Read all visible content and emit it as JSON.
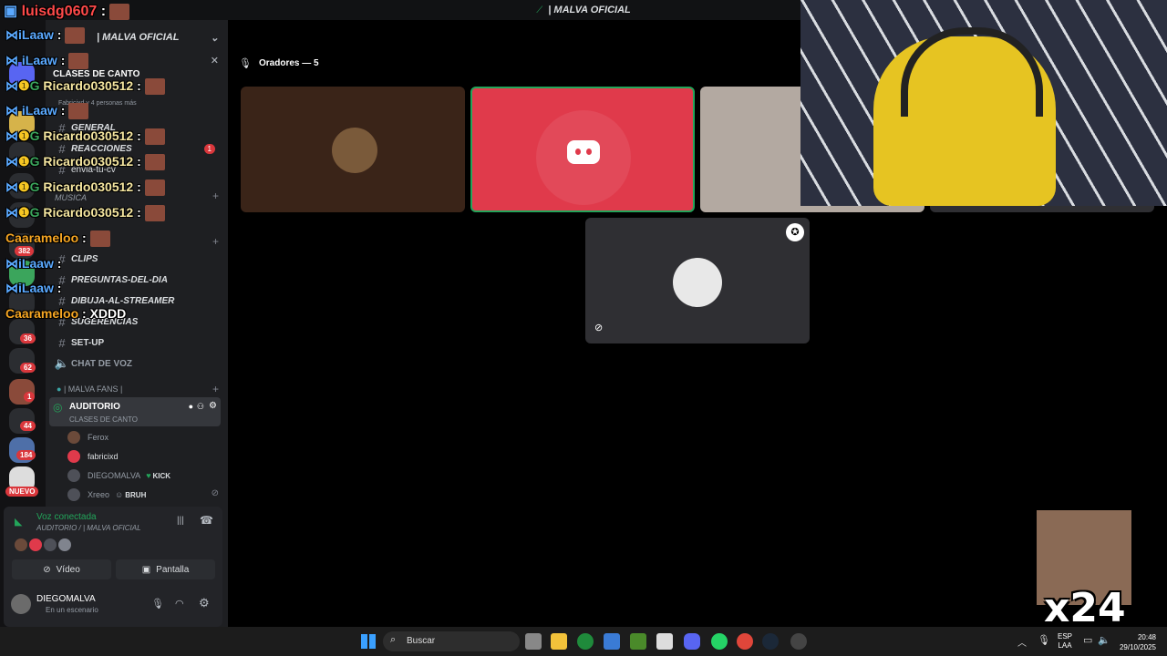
{
  "window": {
    "title": "| MALVA OFICIAL"
  },
  "rail": {
    "badges": [
      "382",
      "1",
      "36",
      "62",
      "1",
      "44",
      "184"
    ],
    "new_label": "NUEVO"
  },
  "server": {
    "name": "| MALVA OFICIAL",
    "event_title": "CLASES DE CANTO",
    "event_sub": "Fabricixd y 4 personas más"
  },
  "channels": [
    {
      "name": "GENERAL"
    },
    {
      "name": "REACCIONES",
      "badge": "1"
    },
    {
      "name": "envia-tu-cv"
    },
    {
      "name": "MUSICA"
    },
    {
      "name": "CLIPS"
    },
    {
      "name": "PREGUNTAS-DEL-DIA"
    },
    {
      "name": "DIBUJA-AL-STREAMER"
    },
    {
      "name": "SUGERENCIAS"
    },
    {
      "name": "SET-UP"
    },
    {
      "name": "CHAT DE VOZ"
    }
  ],
  "fans_category": "| MALVA FANS |",
  "auditorio": {
    "name": "AUDITORIO",
    "topic": "CLASES DE CANTO"
  },
  "stage_users": [
    {
      "name": "Ferox"
    },
    {
      "name": "fabricixd"
    },
    {
      "name": "DIEGOMALVA",
      "tag": "KICK"
    },
    {
      "name": "Xreeo",
      "tag": "BRUH"
    }
  ],
  "voice": {
    "status": "Voz conectada",
    "location": "AUDITORIO / | MALVA OFICIAL",
    "video_label": "Vídeo",
    "screen_label": "Pantalla"
  },
  "user_panel": {
    "name": "DIEGOMALVA",
    "status": "En un escenario"
  },
  "stage": {
    "speakers_label": "Oradores — 5"
  },
  "stream_chat": [
    {
      "user": "luisdg0607",
      "text": ":"
    },
    {
      "user": "iLaaw",
      "text": ":"
    },
    {
      "user": "iLaaw",
      "text": ":"
    },
    {
      "user": "Ricardo030512",
      "text": ":"
    },
    {
      "user": "iLaaw",
      "text": ":"
    },
    {
      "user": "Ricardo030512",
      "text": ":"
    },
    {
      "user": "Ricardo030512",
      "text": ":"
    },
    {
      "user": "Ricardo030512",
      "text": ":"
    },
    {
      "user": "Ricardo030512",
      "text": ":"
    },
    {
      "user": "Caarameloo",
      "text": ":"
    },
    {
      "user": "iLaaw",
      "text": ":"
    },
    {
      "user": "iLaaw",
      "text": ":"
    },
    {
      "user": "Caarameloo",
      "text": ": XDDD"
    }
  ],
  "emote_counter": "x24",
  "taskbar": {
    "search_placeholder": "Buscar",
    "lang": "ESP",
    "layout": "LAA",
    "time": "20:48",
    "date": "29/10/2025"
  },
  "colors": {
    "accent_red": "#e03a4b",
    "voice_green": "#23a55a",
    "chat_name_blue": "#5aa9ff",
    "chat_name_red": "#ff4a4a",
    "chat_name_orange": "#f6a623"
  }
}
